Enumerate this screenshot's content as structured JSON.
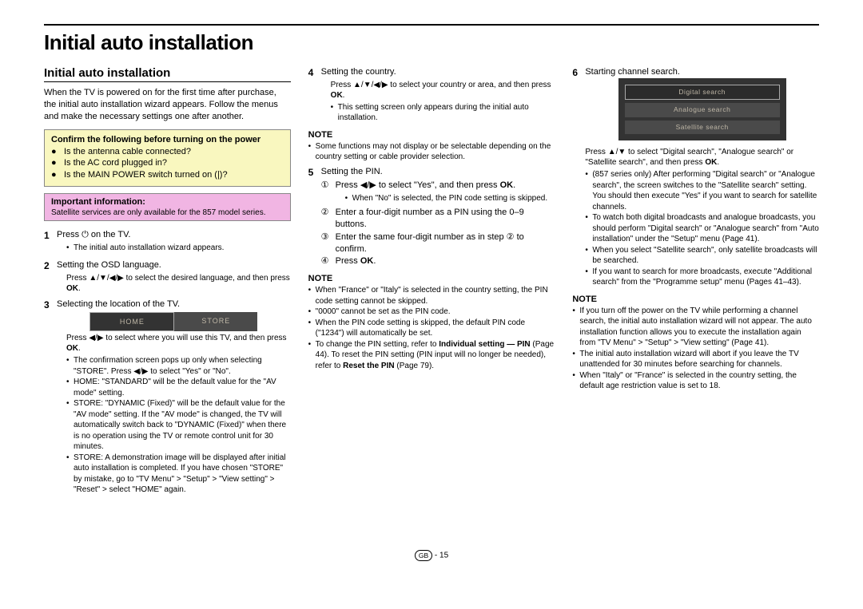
{
  "title": "Initial auto installation",
  "section_heading": "Initial auto installation",
  "intro": "When the TV is powered on for the first time after purchase, the initial auto installation wizard appears. Follow the menus and make the necessary settings one after another.",
  "confirm_box": {
    "title": "Confirm the following before turning on the power",
    "items": [
      "Is the antenna cable connected?",
      "Is the AC cord plugged in?",
      "Is the MAIN POWER switch turned on (|)?"
    ]
  },
  "important_box": {
    "title": "Important information:",
    "text": "Satellite services are only available for the 857 model series."
  },
  "col1_steps": {
    "s1": {
      "num": "1",
      "text": "Press ⏻ on the TV.",
      "sub": [
        "The initial auto installation wizard appears."
      ]
    },
    "s2": {
      "num": "2",
      "text": "Setting the OSD language.",
      "instr": "Press ▲/▼/◀/▶ to select the desired language, and then press OK."
    },
    "s3": {
      "num": "3",
      "text": "Selecting the location of the TV.",
      "homestore": {
        "home": "HOME",
        "store": "STORE"
      },
      "instr": "Press ◀/▶ to select where you will use this TV, and then press OK.",
      "sub": [
        "The confirmation screen pops up only when selecting \"STORE\". Press ◀/▶ to select \"Yes\" or \"No\".",
        "HOME: \"STANDARD\" will be the default value for the \"AV mode\" setting.",
        "STORE: \"DYNAMIC (Fixed)\" will be the default value for the \"AV mode\" setting. If the \"AV mode\" is changed, the TV will automatically switch back to \"DYNAMIC (Fixed)\" when there is no operation using the TV or remote control unit for 30 minutes.",
        "STORE: A demonstration image will be displayed after initial auto installation is completed. If you have chosen \"STORE\" by mistake, go to \"TV Menu\" > \"Setup\" > \"View setting\" > \"Reset\" > select \"HOME\" again."
      ]
    }
  },
  "col2_steps": {
    "s4": {
      "num": "4",
      "text": "Setting the country.",
      "instr": "Press ▲/▼/◀/▶ to select your country or area, and then press OK.",
      "sub": [
        "This setting screen only appears during the initial auto installation."
      ]
    },
    "note4": {
      "heading": "NOTE",
      "items": [
        "Some functions may not display or be selectable depending on the country setting or cable provider selection."
      ]
    },
    "s5": {
      "num": "5",
      "text": "Setting the PIN.",
      "circ": {
        "i1": "Press ◀/▶ to select \"Yes\", and then press OK.",
        "i1sub": [
          "When \"No\" is selected, the PIN code setting is skipped."
        ],
        "i2": "Enter a four-digit number as a PIN using the 0–9 buttons.",
        "i3": "Enter the same four-digit number as in step ② to confirm.",
        "i4": "Press OK."
      }
    },
    "note5": {
      "heading": "NOTE",
      "items": [
        "When \"France\" or \"Italy\" is selected in the country setting, the PIN code setting cannot be skipped.",
        "\"0000\" cannot be set as the PIN code.",
        "When the PIN code setting is skipped, the default PIN code (\"1234\") will automatically be set.",
        "To change the PIN setting, refer to Individual setting — PIN (Page 44). To reset the PIN setting (PIN input will no longer be needed), refer to Reset the PIN (Page 79)."
      ]
    }
  },
  "col3_steps": {
    "s6": {
      "num": "6",
      "text": "Starting channel search.",
      "options": [
        "Digital search",
        "Analogue search",
        "Satellite search"
      ],
      "instr": "Press ▲/▼ to select \"Digital search\", \"Analogue search\" or \"Satellite search\", and then  press OK.",
      "sub": [
        "(857 series only) After performing \"Digital search\" or \"Analogue search\", the screen switches to the \"Satellite search\" setting. You should then execute \"Yes\" if you want to search for satellite channels.",
        "To watch both digital broadcasts and analogue broadcasts, you should perform \"Digital search\" or \"Analogue search\" from \"Auto installation\" under the \"Setup\" menu (Page 41).",
        "When you select \"Satellite search\", only satellite broadcasts will be searched.",
        "If you want to search for more broadcasts, execute \"Additional search\" from the \"Programme setup\" menu (Pages 41–43)."
      ]
    },
    "note6": {
      "heading": "NOTE",
      "items": [
        "If you turn off the power on the TV while performing a channel search, the initial auto installation wizard will not appear. The auto installation function allows you to execute the installation again from \"TV Menu\" > \"Setup\" > \"View setting\" (Page 41).",
        "The initial auto installation wizard will abort if you leave the TV unattended for 30 minutes before searching for channels.",
        "When \"Italy\" or \"France\" is selected in the country setting, the default age restriction value is set to 18."
      ]
    }
  },
  "footer": {
    "gb": "GB",
    "page": "- 15"
  }
}
